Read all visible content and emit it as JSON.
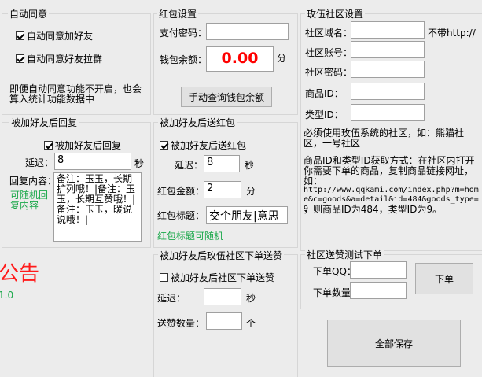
{
  "auto_agree": {
    "title": "自动同意",
    "cb_add_friend": "自动同意加好友",
    "cb_group": "自动同意好友拉群",
    "note": "即便自动同意功能不开启，也会算入统计功能数据中"
  },
  "red_packet": {
    "title": "红包设置",
    "pay_pwd_label": "支付密码：",
    "pay_pwd_value": "",
    "balance_label": "钱包余额：",
    "balance_value": "0.00",
    "balance_unit": "分",
    "query_button": "手动查询钱包余额"
  },
  "community": {
    "title": "玫伍社区设置",
    "domain_label": "社区域名：",
    "domain_value": "",
    "domain_hint": "不带http://",
    "account_label": "社区账号：",
    "account_value": "",
    "password_label": "社区密码：",
    "password_value": "",
    "product_label": "商品ID：",
    "product_value": "",
    "type_label": "类型ID：",
    "type_value": "",
    "info1": "必须使用玫伍系统的社区，如：熊猫社区，一号社区",
    "info2": "商品ID和类型ID获取方式：在社区内打开你需要下单的商品，复制商品链接网址，如：",
    "info_url": "http://www.qqkami.com/index.php?m=home&c=goods&a=detail&id=484&goods_type=9",
    "info3": "，则商品ID为484，类型ID为9。"
  },
  "reply": {
    "title": "被加好友后回复",
    "cb_label": "被加好友后回复",
    "delay_label": "延迟：",
    "delay_value": "8",
    "delay_unit": "秒",
    "content_label": "回复内容：",
    "random_hint": "可随机回复内容",
    "content_value": "备注：玉玉，长期扩列哦！|备注：玉玉，长期互赞哦！|备注：玉玉，暖说说哦！|"
  },
  "send_red": {
    "title": "被加好友后送红包",
    "cb_label": "被加好友后送红包",
    "delay_label": "延迟：",
    "delay_value": "8",
    "delay_unit": "秒",
    "amount_label": "红包金额：",
    "amount_value": "2",
    "amount_unit": "分",
    "title_label": "红包标题：",
    "title_value": "交个朋友|意思",
    "random_hint": "红包标题可随机"
  },
  "notice": {
    "title": "公告",
    "version": "1.0"
  },
  "order_like": {
    "title": "被加好友后玫伍社区下单送赞",
    "cb_label": "被加好友后社区下单送赞",
    "delay_label": "延迟：",
    "delay_value": "",
    "delay_unit": "秒",
    "qty_label": "送赞数量：",
    "qty_value": "",
    "qty_unit": "个"
  },
  "test_order": {
    "title": "社区送赞测试下单",
    "qq_label": "下单QQ：",
    "qq_value": "",
    "qty_label": "下单数量：",
    "qty_value": "",
    "order_button": "下单"
  },
  "save_all_button": "全部保存"
}
